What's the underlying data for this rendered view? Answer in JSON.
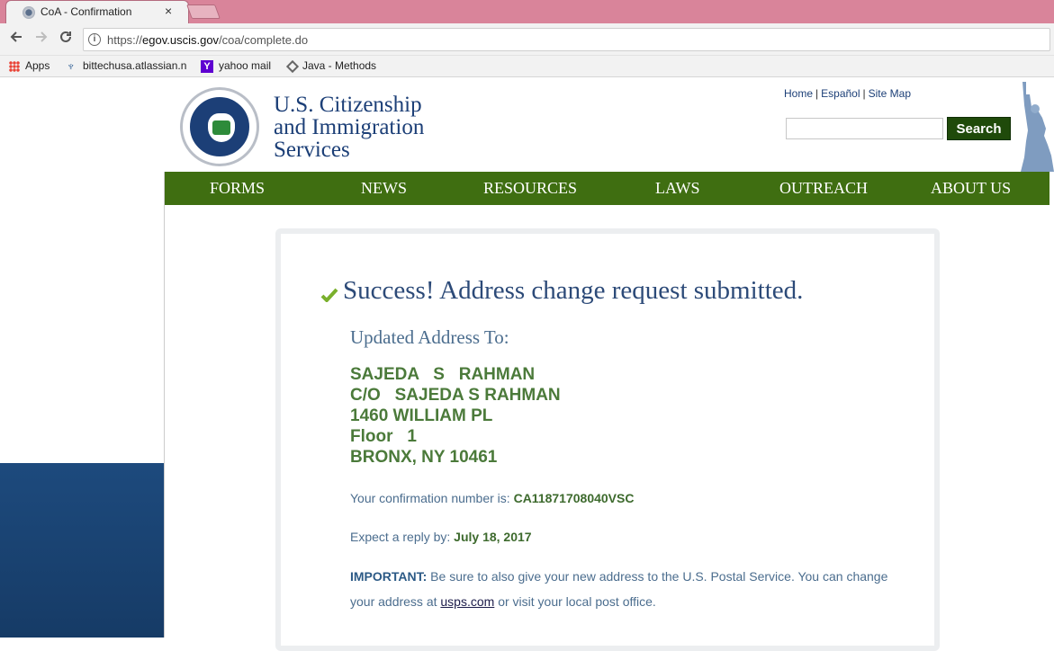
{
  "browser": {
    "tab_title": "CoA - Confirmation",
    "tab_close": "×",
    "url_prefix": "https://",
    "url_host": "egov.uscis.gov",
    "url_path": "/coa/complete.do",
    "back_icon": "back-arrow",
    "forward_icon": "forward-arrow",
    "reload_icon": "reload"
  },
  "bookmarks": [
    {
      "label": "Apps",
      "icon": "apps-grid-icon"
    },
    {
      "label": "bittechusa.atlassian.n",
      "icon": "atlassian-icon"
    },
    {
      "label": "yahoo mail",
      "icon": "yahoo-icon"
    },
    {
      "label": "Java - Methods",
      "icon": "diamond-icon"
    }
  ],
  "header": {
    "agency_line1": "U.S. Citizenship",
    "agency_line2": "and Immigration",
    "agency_line3": "Services",
    "util_home": "Home",
    "util_espanol": "Español",
    "util_sitemap": "Site Map",
    "util_sep": "|",
    "search_button": "Search",
    "search_placeholder": ""
  },
  "nav": [
    "FORMS",
    "NEWS",
    "RESOURCES",
    "LAWS",
    "OUTREACH",
    "ABOUT US"
  ],
  "confirmation": {
    "success_heading": "Success! Address change request submitted.",
    "updated_label": "Updated Address To:",
    "address_lines": [
      "SAJEDA   S   RAHMAN",
      "C/O   SAJEDA S RAHMAN",
      "1460 WILLIAM PL",
      "Floor   1",
      "BRONX, NY 10461"
    ],
    "conf_label": "Your confirmation number is: ",
    "conf_number": "CA11871708040VSC",
    "reply_label": "Expect a reply by: ",
    "reply_date": "July 18, 2017",
    "important_label": "IMPORTANT:",
    "important_text1": " Be sure to also give your new address to the U.S. Postal Service. You can change your address at ",
    "usps_link": "usps.com",
    "important_text2": " or visit your local post office."
  },
  "colors": {
    "nav_green": "#3f6e11",
    "search_green": "#1f4a0a",
    "heading_blue": "#2c4a78",
    "address_green": "#4b7a3a",
    "tab_strip": "#d9849a"
  }
}
